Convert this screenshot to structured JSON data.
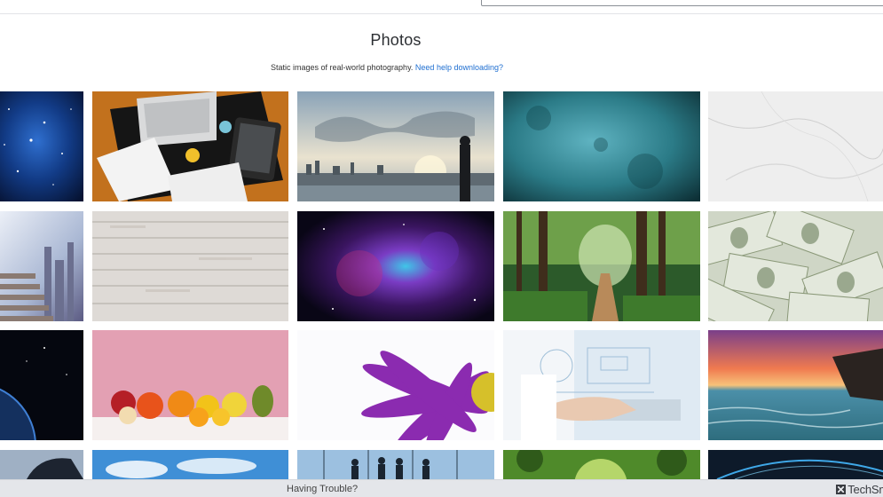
{
  "header": {
    "search_placeholder": ""
  },
  "main": {
    "title": "Photos",
    "subtitle": "Static images of real-world photography.",
    "help_link": "Need help downloading?"
  },
  "gallery": {
    "photos": [
      {
        "name": "photo-galaxy-stars",
        "subject": "blue starfield"
      },
      {
        "name": "photo-desk-laptop",
        "subject": "desk with laptop, tablet and notebook"
      },
      {
        "name": "photo-world-map-skyline",
        "subject": "man overlooking city with world map"
      },
      {
        "name": "photo-teal-texture",
        "subject": "teal grunge texture"
      },
      {
        "name": "photo-white-marble",
        "subject": "white marble"
      },
      {
        "name": "photo-city-staircase",
        "subject": "staircase to city in clouds"
      },
      {
        "name": "photo-white-wood",
        "subject": "white wooden planks"
      },
      {
        "name": "photo-nebula",
        "subject": "purple nebula"
      },
      {
        "name": "photo-forest-path",
        "subject": "forest path"
      },
      {
        "name": "photo-dollar-bills",
        "subject": "hundred dollar bills"
      },
      {
        "name": "photo-earth-space",
        "subject": "earth in dark space"
      },
      {
        "name": "photo-fruit-pink",
        "subject": "citrus fruits on pink background"
      },
      {
        "name": "photo-purple-flower",
        "subject": "purple flower macro"
      },
      {
        "name": "photo-tech-hand",
        "subject": "hand with tech interface"
      },
      {
        "name": "photo-ocean-sunset",
        "subject": "ocean sunset coast"
      },
      {
        "name": "photo-business-person",
        "subject": "business person"
      },
      {
        "name": "photo-blue-sky",
        "subject": "blue sky with clouds"
      },
      {
        "name": "photo-office-silhouettes",
        "subject": "silhouettes in office window"
      },
      {
        "name": "photo-green-canopy",
        "subject": "green tree canopy"
      },
      {
        "name": "photo-light-arc",
        "subject": "light arc on dark"
      }
    ]
  },
  "footer": {
    "trouble": "Having Trouble?",
    "brand": "TechSm"
  },
  "colors": {
    "link": "#1f6fd1",
    "footer_bg": "#e4e6ea"
  }
}
